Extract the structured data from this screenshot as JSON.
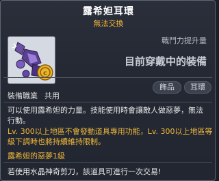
{
  "item": {
    "name": "露希妲耳環",
    "trade_status": "無法交換",
    "icon": "lucid-earring-icon",
    "coin_icon": "gold-coin-icon"
  },
  "stats": {
    "power_label": "戰鬥力提升量",
    "equipped_label": "目前穿戴中的裝備"
  },
  "job": {
    "label": "裝備職業",
    "value": "共用"
  },
  "tags": {
    "category": "飾品",
    "type": "耳環"
  },
  "description": {
    "text": "可以使用露希妲的力量。技能使用時會讓敵人做惡夢，無法行動。",
    "restriction": "Lv. 300以上地區不會發動道具專用功能，Lv. 300以上地區等級下調時也將持續維持限制。",
    "set_name": "露希妲的惡夢1級",
    "note": "若使用水晶神奇剪刀，該道具可進行一次交易!"
  },
  "colors": {
    "title": "#ffffff",
    "trade_status": "#f2b33a",
    "highlight": "#f0b93c",
    "background": "#242934"
  }
}
